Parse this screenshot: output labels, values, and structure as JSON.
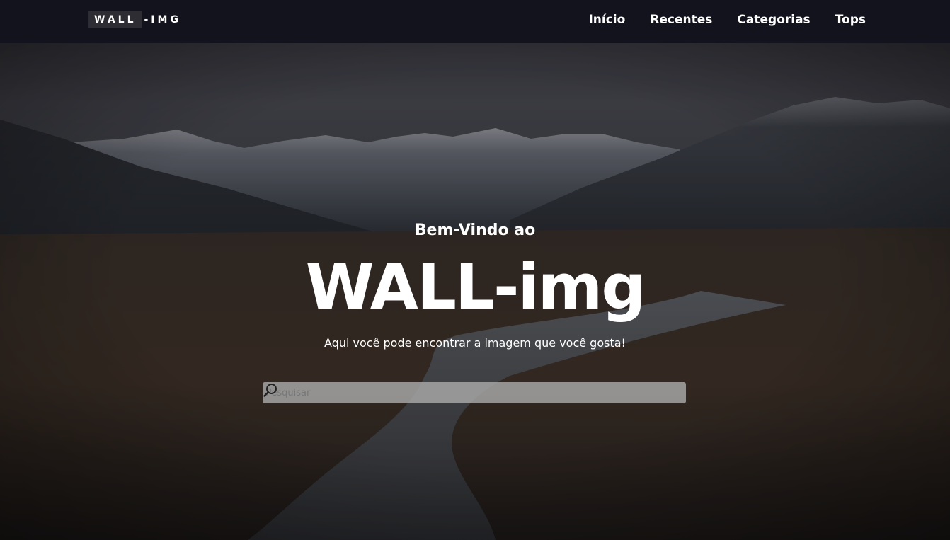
{
  "brand": {
    "logo_box": "WALL",
    "logo_rest": "-IMG"
  },
  "nav": {
    "items": [
      {
        "label": "Início"
      },
      {
        "label": "Recentes"
      },
      {
        "label": "Categorias"
      },
      {
        "label": "Tops"
      }
    ]
  },
  "hero": {
    "welcome": "Bem-Vindo ao",
    "title": "WALL-img",
    "tagline": "Aqui você pode encontrar a imagem que você gosta!"
  },
  "search": {
    "placeholder": "Pesquisar",
    "icon": "search-icon"
  },
  "colors": {
    "navbar_bg": "#13131d",
    "logo_box_bg": "#2d2d33",
    "text": "#ffffff"
  }
}
